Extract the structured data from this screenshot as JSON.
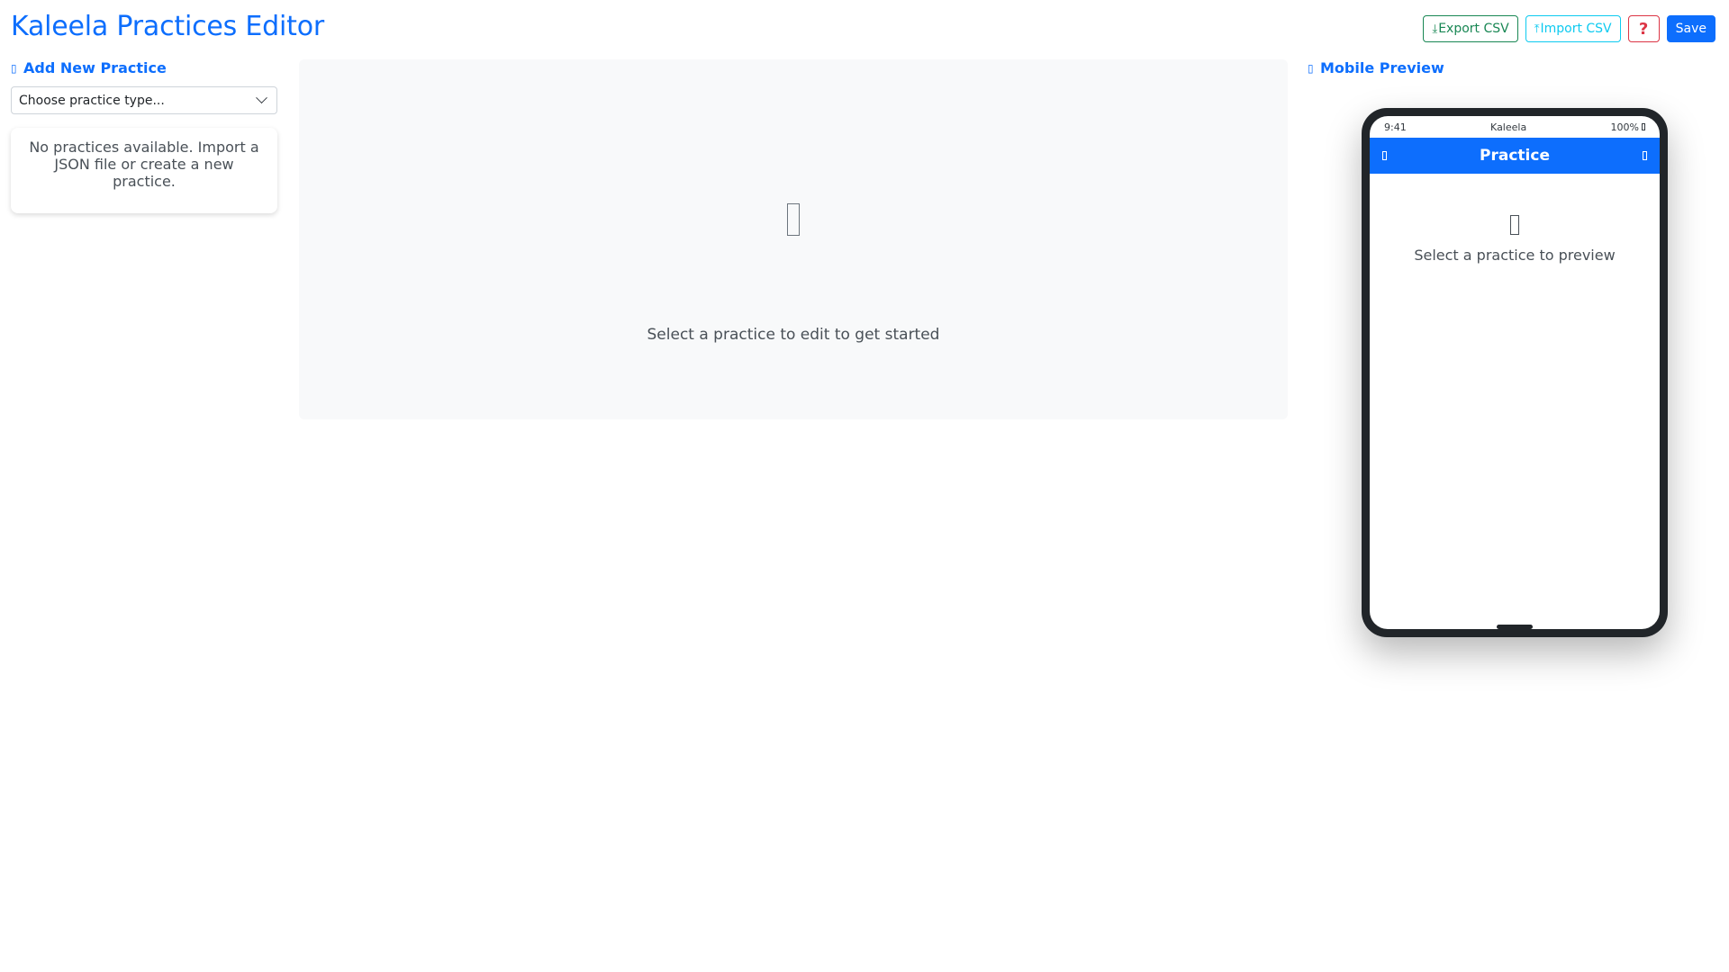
{
  "app": {
    "title": "Kaleela Practices Editor"
  },
  "toolbar": {
    "export_label": "Export CSV",
    "import_label": "Import CSV",
    "help_label": "?",
    "save_label": "Save"
  },
  "left": {
    "heading": "Add New Practice",
    "select_value": "Choose practice type...",
    "empty_message": "No practices available. Import a JSON file or create a new practice."
  },
  "center": {
    "empty_message": "Select a practice to edit to get started"
  },
  "preview": {
    "heading": "Mobile Preview",
    "status_time": "9:41",
    "status_carrier": "Kaleela",
    "status_battery": "100%",
    "app_bar_title": "Practice",
    "empty_message": "Select a practice to preview"
  },
  "colors": {
    "primary": "#0d6efd",
    "success": "#198754",
    "info": "#0dcaf0",
    "danger": "#dc3545",
    "panel_bg": "#f8f9fa",
    "phone_frame": "#212529"
  },
  "icons": {
    "export": "download-icon",
    "import": "upload-icon",
    "add_practice": "plus-circle-icon",
    "preview": "phone-icon",
    "center_empty": "edit-icon",
    "preview_empty": "phone-icon",
    "battery": "battery-icon",
    "back": "back-icon",
    "menu": "menu-icon",
    "select_chevron": "chevron-down-icon"
  }
}
